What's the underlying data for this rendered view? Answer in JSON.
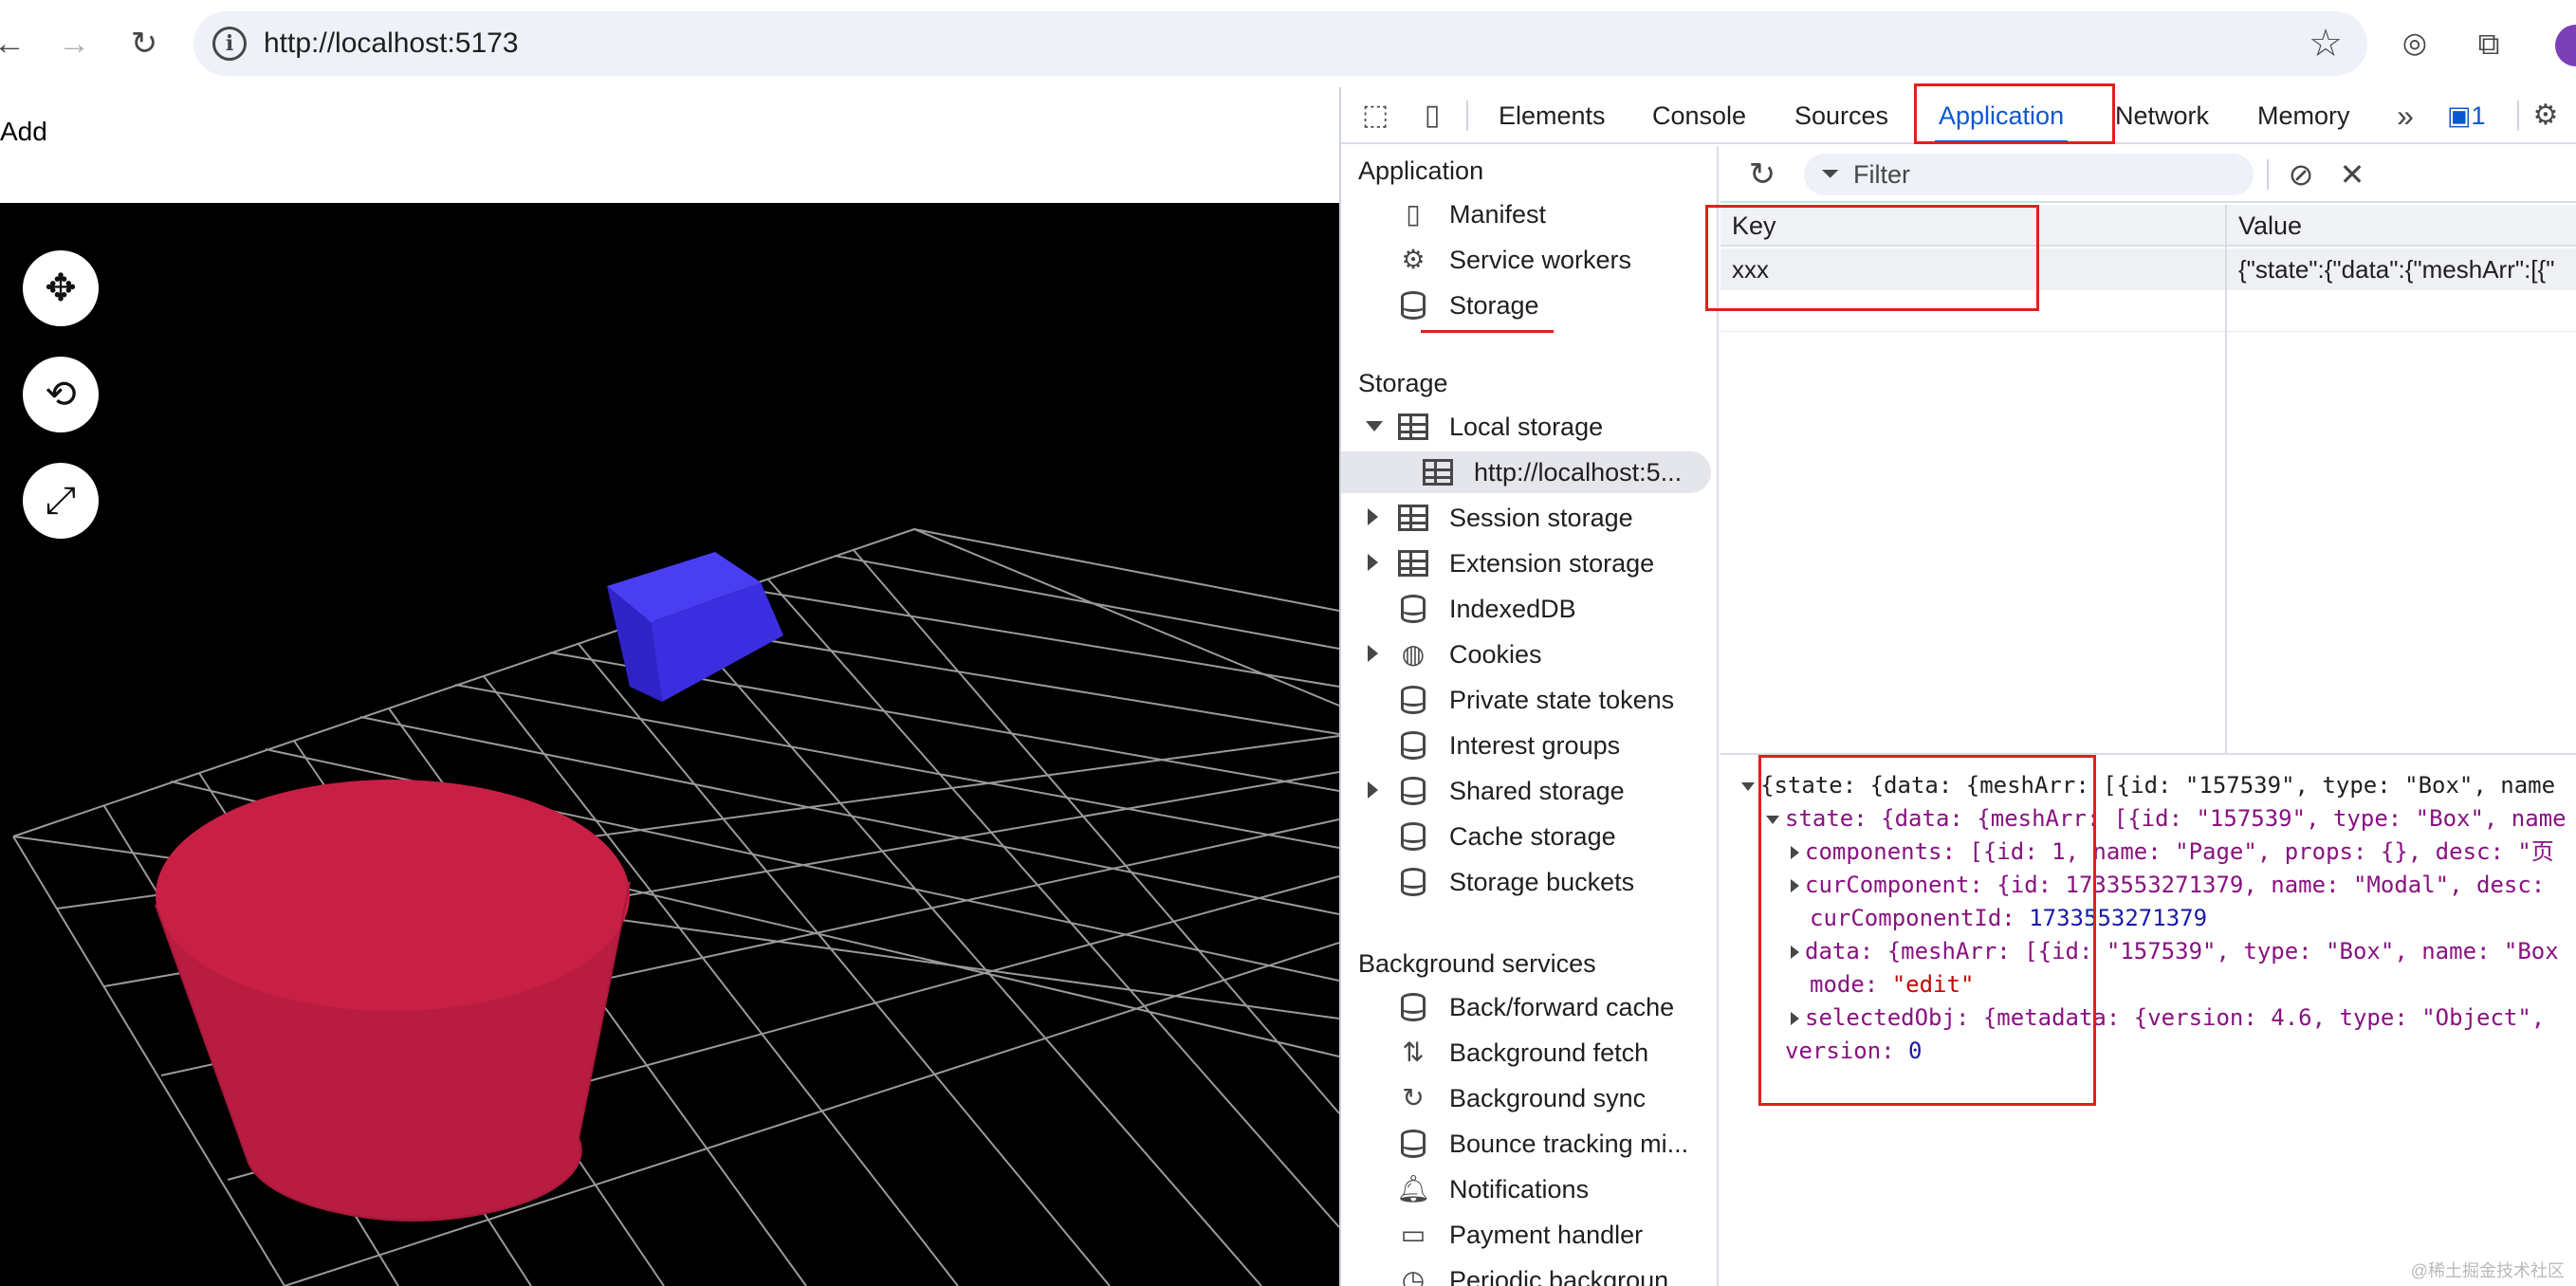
{
  "browser": {
    "url": "http://localhost:5173"
  },
  "page": {
    "add_label": "Add",
    "tool_buttons": {
      "move": "✥",
      "rotate": "⟲",
      "scale": "⤢"
    }
  },
  "devtools": {
    "tabs": [
      "Elements",
      "Console",
      "Sources",
      "Application",
      "Network",
      "Memory"
    ],
    "active_tab": "Application",
    "issues_badge": "1",
    "sidebar": {
      "application_header": "Application",
      "application_items": [
        "Manifest",
        "Service workers",
        "Storage"
      ],
      "storage_header": "Storage",
      "storage_items": {
        "local_storage": "Local storage",
        "local_storage_origin": "http://localhost:5...",
        "session_storage": "Session storage",
        "extension_storage": "Extension storage",
        "indexeddb": "IndexedDB",
        "cookies": "Cookies",
        "private_state_tokens": "Private state tokens",
        "interest_groups": "Interest groups",
        "shared_storage": "Shared storage",
        "cache_storage": "Cache storage",
        "storage_buckets": "Storage buckets"
      },
      "background_header": "Background services",
      "background_items": {
        "back_forward_cache": "Back/forward cache",
        "background_fetch": "Background fetch",
        "background_sync": "Background sync",
        "bounce_tracking": "Bounce tracking mi...",
        "notifications": "Notifications",
        "payment_handler": "Payment handler",
        "periodic_background": "Periodic backgroun"
      }
    },
    "filter_placeholder": "Filter",
    "table": {
      "columns": [
        "Key",
        "Value"
      ],
      "rows": [
        {
          "key": "xxx",
          "value": "{\"state\":{\"data\":{\"meshArr\":[{\""
        }
      ]
    },
    "preview": {
      "root": "{state: {data: {meshArr: [{id: \"157539\", type: \"Box\", name",
      "state": "state: {data: {meshArr: [{id: \"157539\", type: \"Box\", name",
      "components": "components: [{id: 1, name: \"Page\", props: {}, desc: \"页",
      "cur_component": "curComponent: {id: 1733553271379, name: \"Modal\", desc:",
      "cur_component_id_key": "curComponentId:",
      "cur_component_id_val": "1733553271379",
      "data_line": "data: {meshArr: [{id: \"157539\", type: \"Box\", name: \"Box",
      "mode_key": "mode:",
      "mode_val": "\"edit\"",
      "selected_obj": "selectedObj: {metadata: {version: 4.6, type: \"Object\",",
      "version_key": "version:",
      "version_val": "0"
    }
  },
  "watermark": "@稀土掘金技术社区",
  "colors": {
    "accent": "#0b57d0",
    "annotation_red": "#e0201c",
    "box": "#3b2ee0",
    "cylinder": "#c81f45"
  }
}
